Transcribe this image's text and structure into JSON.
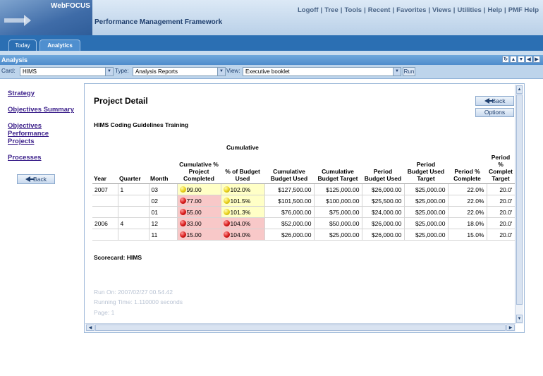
{
  "header": {
    "brand": "WebFOCUS",
    "app_title": "Performance Management Framework",
    "links": [
      "Logoff",
      "Tree",
      "Tools",
      "Recent",
      "Favorites",
      "Views",
      "Utilities",
      "Help",
      "PMF Help"
    ]
  },
  "tabs": [
    {
      "label": "Today"
    },
    {
      "label": "Analytics"
    }
  ],
  "analysis_bar": {
    "title": "Analysis"
  },
  "controls": {
    "card_label": "Card:",
    "card_value": "HIMS",
    "type_label": "Type:",
    "type_value": "Analysis Reports",
    "view_label": "View:",
    "view_value": "Executive booklet",
    "run_label": "Run"
  },
  "leftnav": {
    "items": [
      {
        "label": "Strategy"
      },
      {
        "label": "Objectives Summary"
      },
      {
        "label": "Objectives Performance"
      },
      {
        "label": "Projects"
      },
      {
        "label": "Processes"
      }
    ],
    "back_label": "Back"
  },
  "report": {
    "title": "Project Detail",
    "back_label": "Back",
    "options_label": "Options",
    "subtitle": "HIMS Coding Guidelines Training",
    "group_label": "Cumulative",
    "columns": [
      {
        "label": "Year"
      },
      {
        "label": "Quarter"
      },
      {
        "label": "Month"
      },
      {
        "label": "Cumulative % Project Completed"
      },
      {
        "label": "% of Budget Used"
      },
      {
        "label": "Cumulative Budget Used"
      },
      {
        "label": "Cumulative Budget Target"
      },
      {
        "label": "Period Budget Used"
      },
      {
        "label": "Period Budget Used Target"
      },
      {
        "label": "Period % Complete"
      },
      {
        "label": "Period % Complet Target"
      }
    ],
    "rows": [
      {
        "year": "2007",
        "quarter": "1",
        "month": "03",
        "cum_pct": "99.00",
        "cum_status": "yellow",
        "budget_pct": "102.0%",
        "budget_status": "yellow",
        "cum_used": "$127,500.00",
        "cum_target": "$125,000.00",
        "per_used": "$26,000.00",
        "per_target": "$25,000.00",
        "per_complete": "22.0%",
        "per_complete_target": "20.0'"
      },
      {
        "year": "",
        "quarter": "",
        "month": "02",
        "cum_pct": "77.00",
        "cum_status": "red",
        "budget_pct": "101.5%",
        "budget_status": "yellow",
        "cum_used": "$101,500.00",
        "cum_target": "$100,000.00",
        "per_used": "$25,500.00",
        "per_target": "$25,000.00",
        "per_complete": "22.0%",
        "per_complete_target": "20.0'"
      },
      {
        "year": "",
        "quarter": "",
        "month": "01",
        "cum_pct": "55.00",
        "cum_status": "red",
        "budget_pct": "101.3%",
        "budget_status": "yellow",
        "cum_used": "$76,000.00",
        "cum_target": "$75,000.00",
        "per_used": "$24,000.00",
        "per_target": "$25,000.00",
        "per_complete": "22.0%",
        "per_complete_target": "20.0'"
      },
      {
        "year": "2006",
        "quarter": "4",
        "month": "12",
        "cum_pct": "33.00",
        "cum_status": "red",
        "budget_pct": "104.0%",
        "budget_status": "red",
        "cum_used": "$52,000.00",
        "cum_target": "$50,000.00",
        "per_used": "$26,000.00",
        "per_target": "$25,000.00",
        "per_complete": "18.0%",
        "per_complete_target": "20.0'"
      },
      {
        "year": "",
        "quarter": "",
        "month": "11",
        "cum_pct": "15.00",
        "cum_status": "red",
        "budget_pct": "104.0%",
        "budget_status": "red",
        "cum_used": "$26,000.00",
        "cum_target": "$25,000.00",
        "per_used": "$26,000.00",
        "per_target": "$25,000.00",
        "per_complete": "15.0%",
        "per_complete_target": "20.0'"
      }
    ],
    "scorecard": "Scorecard: HIMS",
    "run_on": "Run On: 2007/02/27 00.54.42",
    "running_time": "Running Time: 1.110000 seconds",
    "page": "Page: 1"
  },
  "colors": {
    "header_blue": "#2b6fb3",
    "link_purple": "#3b1f8a",
    "status_yellow_bg": "#ffffc6",
    "status_red_bg": "#f8c8c8"
  }
}
